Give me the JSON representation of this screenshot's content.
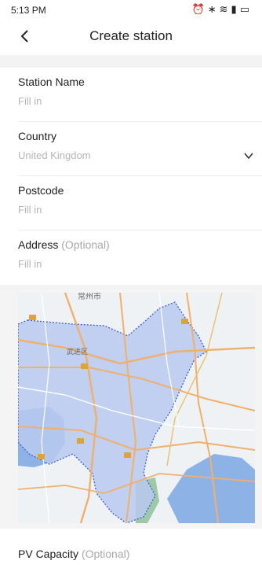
{
  "status": {
    "time": "5:13 PM"
  },
  "header": {
    "title": "Create station"
  },
  "form": {
    "station_name": {
      "label": "Station Name",
      "placeholder": "Fill in"
    },
    "country": {
      "label": "Country",
      "value": "United Kingdom"
    },
    "postcode": {
      "label": "Postcode",
      "placeholder": "Fill in"
    },
    "address": {
      "label": "Address",
      "optional": "(Optional)",
      "placeholder": "Fill in"
    }
  },
  "map": {
    "labels": {
      "top": "常州市",
      "district": "武进区"
    }
  },
  "pv_capacity": {
    "label": "PV Capacity",
    "optional": "(Optional)"
  },
  "colors": {
    "background_gray": "#f3f3f3",
    "placeholder": "#b5b5b5",
    "region_fill": "#b9c9ee",
    "region_border": "#3a5fcd",
    "water": "#8db2e6",
    "road": "#f0b06a"
  }
}
